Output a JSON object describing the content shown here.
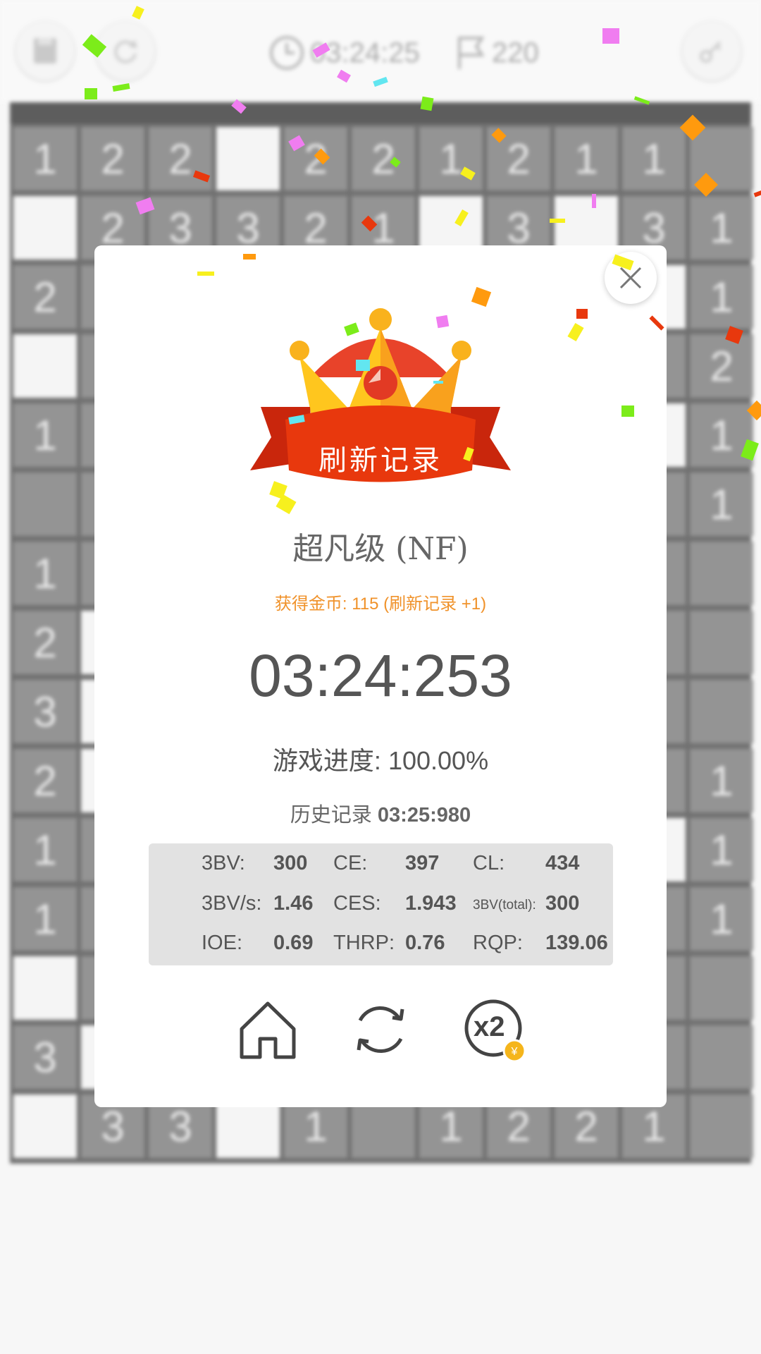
{
  "topbar": {
    "timer": "03:24:25",
    "flags": "220"
  },
  "board": {
    "rows": [
      [
        "1",
        "2",
        "2",
        "W",
        "2",
        "2",
        "1",
        "2",
        "1",
        "1",
        ""
      ],
      [
        "W",
        "2",
        "3",
        "3",
        "2",
        "1",
        "W",
        "3",
        "W",
        "3",
        "1"
      ],
      [
        "2",
        "",
        "",
        "",
        "",
        "",
        "",
        "",
        "",
        "W",
        "1"
      ],
      [
        "W",
        "",
        "",
        "",
        "",
        "",
        "",
        "",
        "",
        "",
        "2"
      ],
      [
        "1",
        "",
        "",
        "",
        "",
        "",
        "",
        "",
        "",
        "W",
        "1"
      ],
      [
        "",
        "",
        "",
        "",
        "",
        "",
        "",
        "",
        "",
        "",
        "1"
      ],
      [
        "1",
        "",
        "",
        "",
        "",
        "",
        "",
        "",
        "",
        "",
        ""
      ],
      [
        "2",
        "W",
        "",
        "",
        "",
        "",
        "",
        "",
        "",
        "",
        ""
      ],
      [
        "3",
        "W",
        "",
        "",
        "",
        "",
        "",
        "",
        "",
        "",
        ""
      ],
      [
        "2",
        "W",
        "",
        "",
        "",
        "",
        "",
        "",
        "",
        "",
        "1"
      ],
      [
        "1",
        "",
        "",
        "",
        "",
        "",
        "",
        "",
        "",
        "W",
        "1"
      ],
      [
        "1",
        "",
        "",
        "",
        "",
        "",
        "",
        "",
        "",
        "",
        "1"
      ],
      [
        "W",
        "",
        "",
        "",
        "",
        "",
        "",
        "",
        "",
        "",
        ""
      ],
      [
        "3",
        "W",
        "",
        "",
        "",
        "",
        "",
        "",
        "",
        "",
        ""
      ],
      [
        "W",
        "3",
        "3",
        "W",
        "1",
        "",
        "1",
        "2",
        "2",
        "1",
        ""
      ]
    ]
  },
  "dialog": {
    "banner_text": "刷新记录",
    "level": "超凡级 (NF)",
    "reward": "获得金币: 115 (刷新记录 +1)",
    "time": "03:24:253",
    "progress_label": "游戏进度:",
    "progress_value": "100.00%",
    "history_label": "历史记录",
    "history_value": "03:25:980",
    "stats": [
      [
        {
          "label": "3BV:",
          "value": "300"
        },
        {
          "label": "CE:",
          "value": "397"
        },
        {
          "label": "CL:",
          "value": "434"
        }
      ],
      [
        {
          "label": "3BV/s:",
          "value": "1.46"
        },
        {
          "label": "CES:",
          "value": "1.943"
        },
        {
          "label": "3BV(total):",
          "value": "300"
        }
      ],
      [
        {
          "label": "IOE:",
          "value": "0.69"
        },
        {
          "label": "THRP:",
          "value": "0.76"
        },
        {
          "label": "RQP:",
          "value": "139.06"
        }
      ]
    ],
    "buttons": {
      "home": "home-icon",
      "restart": "restart-icon",
      "double": "x2"
    }
  },
  "colors": {
    "reward": "#f0922a",
    "crown_gold": "#ffc61e",
    "ribbon_red": "#e8380d"
  }
}
